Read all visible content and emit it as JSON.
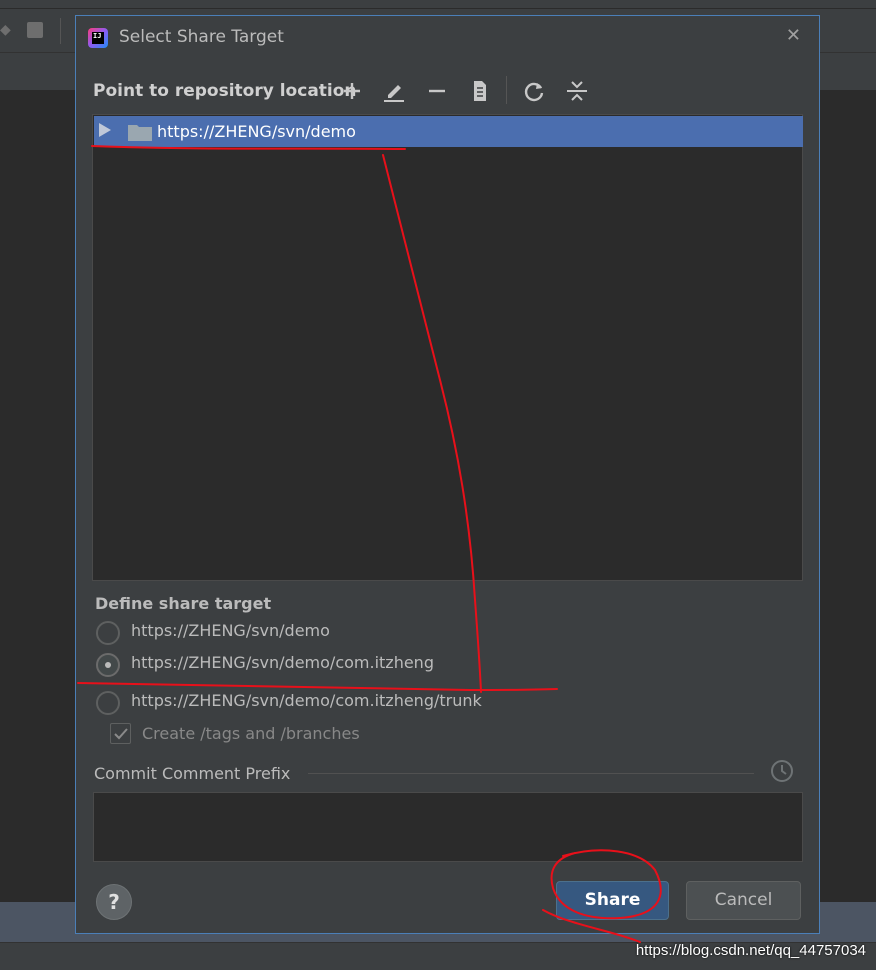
{
  "dialog": {
    "title": "Select Share Target",
    "close_glyph": "✕",
    "repo_section_label": "Point to repository location",
    "toolbar_icons": [
      "add-icon",
      "edit-icon",
      "remove-icon",
      "browse-icon",
      "refresh-icon",
      "collapse-icon"
    ],
    "tree": {
      "items": [
        {
          "label": "https://ZHENG/svn/demo",
          "selected": true,
          "expanded": false
        }
      ]
    },
    "define_section_label": "Define share target",
    "share_targets": [
      {
        "label": "https://ZHENG/svn/demo",
        "checked": false
      },
      {
        "label": "https://ZHENG/svn/demo/com.itzheng",
        "checked": true
      },
      {
        "label": "https://ZHENG/svn/demo/com.itzheng/trunk",
        "checked": false
      }
    ],
    "create_tags_label": "Create /tags and /branches",
    "create_tags_checked": true,
    "create_tags_enabled": false,
    "commit_prefix_label": "Commit Comment Prefix",
    "commit_prefix_value": "",
    "help_label": "?",
    "share_button": "Share",
    "cancel_button": "Cancel"
  },
  "watermark": "https://blog.csdn.net/qq_44757034",
  "colors": {
    "dialog_bg": "#3c3f41",
    "selection": "#4b6eaf",
    "primary_button": "#365880",
    "annotation": "#e8101a"
  }
}
